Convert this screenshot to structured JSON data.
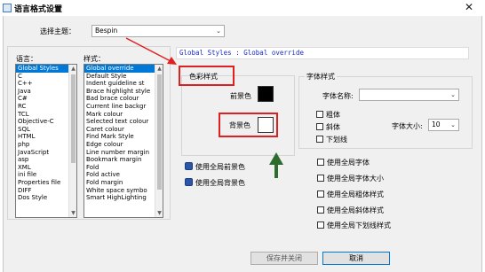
{
  "window": {
    "title": "语言格式设置",
    "close_glyph": "✕"
  },
  "theme": {
    "label": "选择主题：",
    "value": "Bespin"
  },
  "languages": {
    "label": "语言：",
    "items": [
      "Global Styles",
      "C",
      "C++",
      "Java",
      "C#",
      "RC",
      "TCL",
      "Objective-C",
      "SQL",
      "HTML",
      "php",
      "JavaScript",
      "asp",
      "XML",
      "ini file",
      "Properties file",
      "DIFF",
      "Dos Style"
    ],
    "selected_index": 0
  },
  "styles": {
    "label": "样式：",
    "items": [
      "Global override",
      "Default Style",
      "Indent guideline st",
      "Brace highlight style",
      "Bad brace colour",
      "Current line backgr",
      "Mark colour",
      "Selected text colour",
      "Caret colour",
      "Find Mark Style",
      "Edge colour",
      "Line number margin",
      "Bookmark margin",
      "Fold",
      "Fold active",
      "Fold margin",
      "White space symbo",
      "Smart HighLighting"
    ],
    "selected_index": 0
  },
  "banner": "Global Styles : Global override",
  "color_style": {
    "group_label": "色彩样式",
    "fg_label": "前景色",
    "bg_label": "背景色",
    "fg_color": "#000000",
    "bg_color": "#ffffff"
  },
  "font_style": {
    "group_label": "字体样式",
    "name_label": "字体名称:",
    "name_value": "",
    "bold_label": "粗体",
    "italic_label": "斜体",
    "underline_label": "下划线",
    "size_label": "字体大小:",
    "size_value": "10"
  },
  "use_global_fg": "使用全局前景色",
  "use_global_bg": "使用全局背景色",
  "global_options": [
    "使用全局字体",
    "使用全局字体大小",
    "使用全局粗体样式",
    "使用全局斜体样式",
    "使用全局下划线样式"
  ],
  "buttons": {
    "save_close": "保存并关闭",
    "cancel": "取消"
  },
  "colors": {
    "accent_blue": "#0078d7",
    "annotation_red": "#e02020",
    "annotation_green": "#2e6b2e",
    "banner_text": "#1c2fc4"
  }
}
